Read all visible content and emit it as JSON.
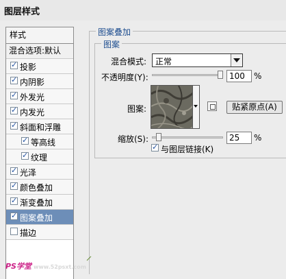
{
  "window": {
    "title": "图层样式"
  },
  "style_list": {
    "header": "样式",
    "blend_options": "混合选项:默认",
    "items": [
      {
        "label": "投影",
        "checked": true,
        "indent": false,
        "selected": false
      },
      {
        "label": "内阴影",
        "checked": true,
        "indent": false,
        "selected": false
      },
      {
        "label": "外发光",
        "checked": true,
        "indent": false,
        "selected": false
      },
      {
        "label": "内发光",
        "checked": true,
        "indent": false,
        "selected": false
      },
      {
        "label": "斜面和浮雕",
        "checked": true,
        "indent": false,
        "selected": false
      },
      {
        "label": "等高线",
        "checked": true,
        "indent": true,
        "selected": false
      },
      {
        "label": "纹理",
        "checked": true,
        "indent": true,
        "selected": false
      },
      {
        "label": "光泽",
        "checked": true,
        "indent": false,
        "selected": false
      },
      {
        "label": "颜色叠加",
        "checked": true,
        "indent": false,
        "selected": false
      },
      {
        "label": "渐变叠加",
        "checked": true,
        "indent": false,
        "selected": false
      },
      {
        "label": "图案叠加",
        "checked": true,
        "indent": false,
        "selected": true
      },
      {
        "label": "描边",
        "checked": false,
        "indent": false,
        "selected": false
      }
    ]
  },
  "panel": {
    "group_title": "图案叠加",
    "sub_title": "图案",
    "blend_mode_label": "混合模式:",
    "blend_mode_value": "正常",
    "opacity_label": "不透明度(Y):",
    "opacity_value": "100",
    "opacity_level": 1.0,
    "percent": "%",
    "pattern_label": "图案:",
    "snap_origin_button": "贴紧原点(A)",
    "scale_label": "缩放(S):",
    "scale_value": "25",
    "scale_level": 0.06,
    "link_label": "与图层链接(K)",
    "link_checked": true
  },
  "watermark": {
    "text": "PS学堂",
    "site": "www.52psxt.com"
  },
  "colors": {
    "selected_bg": "#6d8eb8",
    "group_title": "#1d4d8f",
    "watermark": "#cc2288"
  }
}
